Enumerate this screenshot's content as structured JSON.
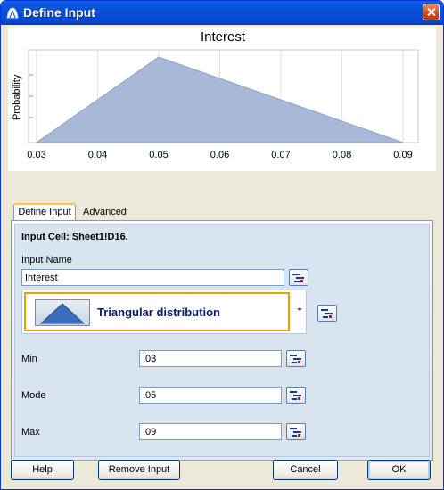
{
  "window": {
    "title": "Define Input"
  },
  "chart_data": {
    "type": "area",
    "title": "Interest",
    "xlabel": "",
    "ylabel": "Probability",
    "x": [
      0.03,
      0.05,
      0.09
    ],
    "y": [
      0,
      1,
      0
    ],
    "xlim": [
      0.03,
      0.09
    ],
    "xticks": [
      "0.03",
      "0.04",
      "0.05",
      "0.06",
      "0.07",
      "0.08",
      "0.09"
    ],
    "grid": true,
    "fill_color": "#a7b9d6",
    "line_color": "#8aa2c8"
  },
  "tabs": [
    {
      "label": "Define Input",
      "active": true
    },
    {
      "label": "Advanced",
      "active": false
    }
  ],
  "form": {
    "input_cell": "Input Cell: Sheet1!D16.",
    "input_name_label": "Input Name",
    "input_name_value": "Interest",
    "distribution": "Triangular distribution",
    "min_label": "Min",
    "min_value": ".03",
    "mode_label": "Mode",
    "mode_value": ".05",
    "max_label": "Max",
    "max_value": ".09"
  },
  "buttons": {
    "help": "Help",
    "remove_input": "Remove Input",
    "cancel": "Cancel",
    "ok": "OK"
  },
  "colors": {
    "titlebar": "#0a4fd6",
    "accent_border": "#e8a200",
    "panel": "#d9e4f1"
  }
}
